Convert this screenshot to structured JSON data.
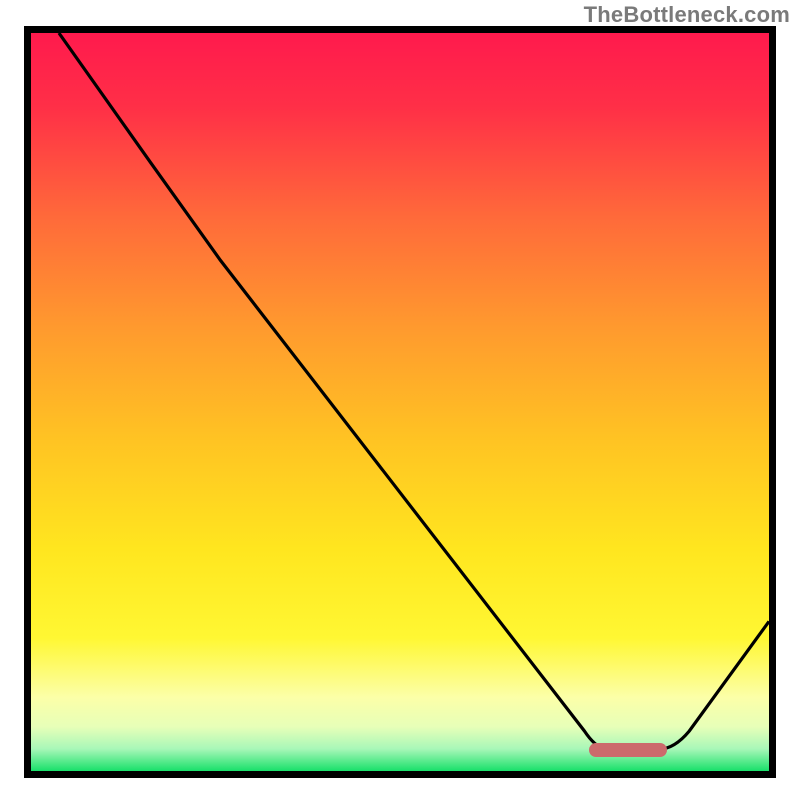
{
  "watermark": "TheBottleneck.com",
  "chart_data": {
    "type": "line",
    "title": "",
    "xlabel": "",
    "ylabel": "",
    "xlim": [
      0,
      100
    ],
    "ylim": [
      0,
      100
    ],
    "axes_visible": false,
    "grid": false,
    "background_gradient": {
      "direction": "vertical",
      "stops": [
        {
          "pos": 0.0,
          "color": "#ff1a4d"
        },
        {
          "pos": 0.25,
          "color": "#ff6a3a"
        },
        {
          "pos": 0.55,
          "color": "#ffc323"
        },
        {
          "pos": 0.82,
          "color": "#fff733"
        },
        {
          "pos": 0.94,
          "color": "#e7ffb8"
        },
        {
          "pos": 1.0,
          "color": "#18e06a"
        }
      ]
    },
    "series": [
      {
        "name": "bottleneck-curve",
        "color": "#000000",
        "x": [
          4,
          16,
          26,
          40,
          55,
          70,
          76,
          80,
          85,
          90,
          100
        ],
        "y": [
          100,
          82,
          70,
          50,
          30,
          10,
          3,
          3,
          3,
          7,
          20
        ]
      }
    ],
    "annotations": [
      {
        "name": "optimal-range-marker",
        "type": "segment",
        "x_start": 76,
        "x_end": 86,
        "y": 3,
        "color": "#cc6a6c"
      }
    ]
  },
  "colors": {
    "frame_border": "#000000",
    "marker": "#cc6a6c",
    "watermark_text": "#7a7a7a"
  }
}
